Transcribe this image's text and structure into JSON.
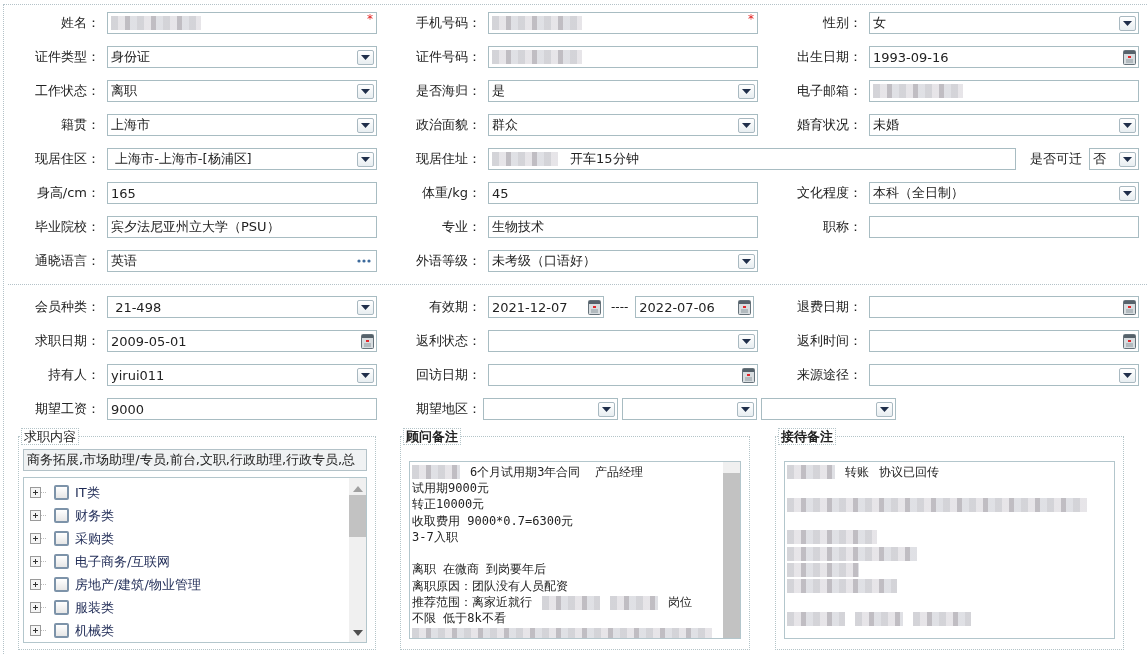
{
  "section_personal": {
    "rows": [
      {
        "cells": [
          {
            "label": "姓名：",
            "kind": "text",
            "redacted": true,
            "required_mark": "*"
          },
          {
            "label": "手机号码：",
            "kind": "text",
            "redacted": true,
            "required_mark": "*"
          },
          {
            "label": "性别：",
            "kind": "select",
            "value": "女"
          }
        ]
      },
      {
        "cells": [
          {
            "label": "证件类型：",
            "kind": "select",
            "value": "身份证"
          },
          {
            "label": "证件号码：",
            "kind": "text",
            "redacted": true
          },
          {
            "label": "出生日期：",
            "kind": "date",
            "value": "1993-09-16"
          }
        ]
      },
      {
        "cells": [
          {
            "label": "工作状态：",
            "kind": "select",
            "value": "离职"
          },
          {
            "label": "是否海归：",
            "kind": "select",
            "value": "是"
          },
          {
            "label": "电子邮箱：",
            "kind": "text",
            "redacted": true
          }
        ]
      },
      {
        "cells": [
          {
            "label": "籍贯：",
            "kind": "select",
            "value": "上海市"
          },
          {
            "label": "政治面貌：",
            "kind": "select",
            "value": "群众"
          },
          {
            "label": "婚育状况：",
            "kind": "select",
            "value": "未婚"
          }
        ]
      },
      {
        "cells": [
          {
            "label": "现居住区：",
            "kind": "select",
            "value": " 上海市-上海市-[杨浦区]"
          },
          {
            "label": "现居住址：",
            "kind": "address",
            "redacted": true,
            "value": "开车15分钟",
            "extra": {
              "label": "是否可迁",
              "kind": "select",
              "value": "否"
            }
          }
        ]
      },
      {
        "cells": [
          {
            "label": "身高/cm：",
            "kind": "text",
            "value": "165"
          },
          {
            "label": "体重/kg：",
            "kind": "text",
            "value": "45"
          },
          {
            "label": "文化程度：",
            "kind": "select",
            "value": "本科（全日制）"
          }
        ]
      },
      {
        "cells": [
          {
            "label": "毕业院校：",
            "kind": "text",
            "value": "宾夕法尼亚州立大学（PSU）"
          },
          {
            "label": "专业：",
            "kind": "text",
            "value": "生物技术"
          },
          {
            "label": "职称：",
            "kind": "text"
          }
        ]
      },
      {
        "cells": [
          {
            "label": "通晓语言：",
            "kind": "picker",
            "value": "英语"
          },
          {
            "label": "外语等级：",
            "kind": "select",
            "value": "未考级（口语好）"
          }
        ]
      }
    ]
  },
  "section_member": {
    "rows": [
      {
        "cells": [
          {
            "label": "会员种类：",
            "kind": "select",
            "value": " 21-498"
          },
          {
            "label": "有效期：",
            "kind": "range",
            "from": "2021-12-07",
            "separator": "----",
            "to": "2022-07-06"
          },
          {
            "label": "退费日期：",
            "kind": "date"
          }
        ]
      },
      {
        "cells": [
          {
            "label": "求职日期：",
            "kind": "date",
            "value": "2009-05-01"
          },
          {
            "label": "返利状态：",
            "kind": "select"
          },
          {
            "label": "返利时间：",
            "kind": "date"
          }
        ]
      },
      {
        "cells": [
          {
            "label": "持有人：",
            "kind": "select",
            "value": "yirui011"
          },
          {
            "label": "回访日期：",
            "kind": "date"
          },
          {
            "label": "来源途径：",
            "kind": "select"
          }
        ]
      },
      {
        "cells": [
          {
            "label": "期望工资：",
            "kind": "text",
            "value": "9000"
          },
          {
            "label": "期望地区：",
            "kind": "region",
            "parts": [
              {
                "kind": "select"
              },
              {
                "kind": "select"
              },
              {
                "kind": "select"
              }
            ]
          }
        ]
      }
    ]
  },
  "panels": [
    {
      "kind": "tree",
      "legend": "求职内容",
      "summary": "商务拓展,市场助理/专员,前台,文职,行政助理,行政专员,总",
      "items": [
        {
          "label": "IT类",
          "expanded": false,
          "checked": false
        },
        {
          "label": "财务类",
          "expanded": false,
          "checked": false
        },
        {
          "label": "采购类",
          "expanded": false,
          "checked": false
        },
        {
          "label": "电子商务/互联网",
          "expanded": false,
          "checked": false
        },
        {
          "label": "房地产/建筑/物业管理",
          "expanded": false,
          "checked": false
        },
        {
          "label": "服装类",
          "expanded": false,
          "checked": false
        },
        {
          "label": "机械类",
          "expanded": false,
          "checked": false
        }
      ]
    },
    {
      "kind": "notes",
      "legend": "顾问备注",
      "scrollbar": true,
      "lines": [
        {
          "segments": [
            {
              "kind": "redacted"
            },
            {
              "kind": "text",
              "text": "6个月试用期3年合同  产品经理"
            }
          ]
        },
        {
          "segments": [
            {
              "kind": "text",
              "text": "试用期9000元"
            }
          ]
        },
        {
          "segments": [
            {
              "kind": "text",
              "text": "转正10000元"
            }
          ]
        },
        {
          "segments": [
            {
              "kind": "text",
              "text": "收取费用 9000*0.7=6300元"
            }
          ]
        },
        {
          "segments": [
            {
              "kind": "text",
              "text": "3-7入职"
            }
          ]
        },
        {
          "kind": "blank"
        },
        {
          "kind": "text",
          "segments": [
            {
              "kind": "text",
              "text": "离职 在微商 到岗要年后"
            }
          ]
        },
        {
          "segments": [
            {
              "kind": "text",
              "text": "离职原因：团队没有人员配资"
            }
          ]
        },
        {
          "segments": [
            {
              "kind": "text",
              "text": "推荐范围：离家近就行"
            },
            {
              "kind": "redacted"
            },
            {
              "kind": "redacted"
            },
            {
              "kind": "text",
              "text": "岗位"
            }
          ]
        },
        {
          "segments": [
            {
              "kind": "text",
              "text": "不限 低于8k不看"
            }
          ]
        },
        {
          "segments": [
            {
              "kind": "redacted"
            }
          ]
        }
      ]
    },
    {
      "kind": "notes",
      "legend": "接待备注",
      "scrollbar": false,
      "lines": [
        {
          "segments": [
            {
              "kind": "redacted"
            },
            {
              "kind": "text",
              "text": "转账"
            },
            {
              "kind": "text",
              "text": "协议已回传"
            }
          ]
        },
        {
          "kind": "blank"
        },
        {
          "segments": [
            {
              "kind": "redacted"
            }
          ]
        },
        {
          "kind": "blank"
        },
        {
          "segments": [
            {
              "kind": "redacted"
            }
          ]
        },
        {
          "segments": [
            {
              "kind": "redacted"
            }
          ]
        },
        {
          "segments": [
            {
              "kind": "redacted"
            }
          ]
        },
        {
          "segments": [
            {
              "kind": "redacted"
            }
          ]
        },
        {
          "kind": "blank"
        },
        {
          "segments": [
            {
              "kind": "redacted"
            },
            {
              "kind": "redacted"
            },
            {
              "kind": "redacted"
            }
          ]
        }
      ]
    }
  ]
}
